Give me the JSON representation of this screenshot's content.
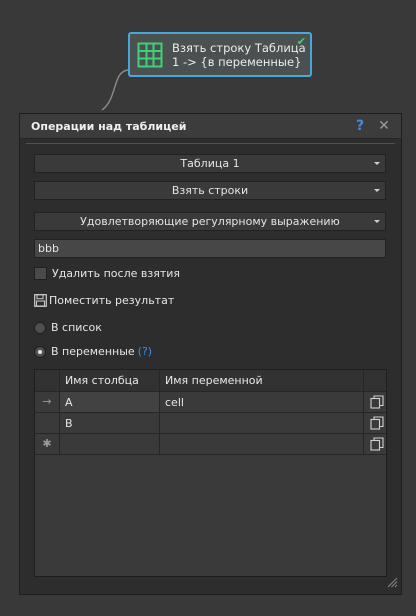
{
  "node": {
    "title": "Взять строку Таблица\n1 -> {в переменные}",
    "icon": "table-icon",
    "status_icon": "check-icon",
    "accent": "#4aa8d8"
  },
  "dialog": {
    "title": "Операции над таблицей",
    "help_label": "?",
    "close_label": "✕",
    "table_select": "Таблица 1",
    "operation_select": "Взять строки",
    "condition_select": "Удовлетворяющие регулярному выражению",
    "regex_value": "bbb",
    "delete_after_label": "Удалить после взятия",
    "delete_after_checked": false,
    "place_result_label": "Поместить результат",
    "radio_list_label": "В список",
    "radio_vars_label": "В переменные",
    "radio_vars_help": "(?)",
    "selected_target": "В переменные",
    "grid": {
      "headers": [
        "Имя столбца",
        "Имя переменной"
      ],
      "rows": [
        {
          "marker": "→",
          "column": "A",
          "variable": "cell"
        },
        {
          "marker": "",
          "column": "B",
          "variable": ""
        },
        {
          "marker": "✱",
          "column": "",
          "variable": ""
        }
      ]
    }
  }
}
